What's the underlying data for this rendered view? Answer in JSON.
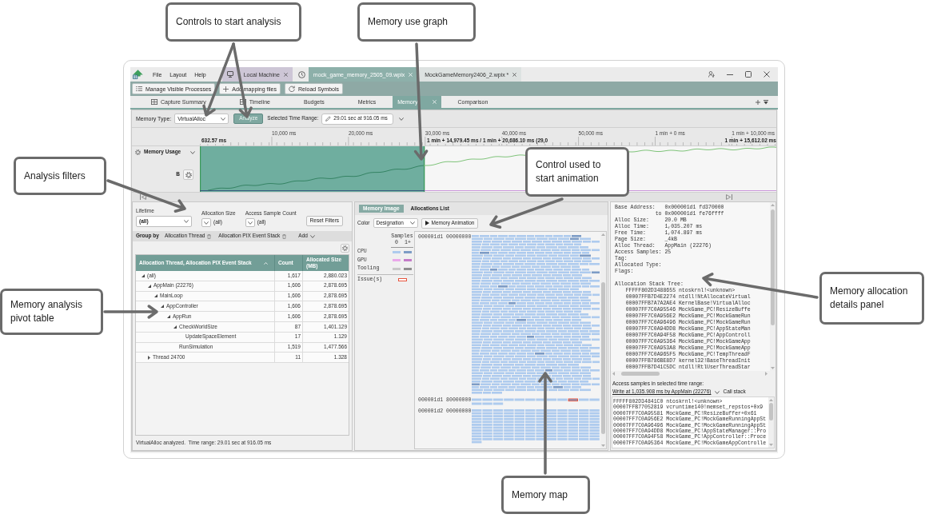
{
  "callouts": [
    {
      "text": "Controls to start analysis"
    },
    {
      "text": "Memory use graph"
    },
    {
      "text": "Analysis filters"
    },
    {
      "text": "Control used to start animation"
    },
    {
      "text": "Memory analysis pivot table"
    },
    {
      "text": "Memory allocation details panel"
    },
    {
      "text": "Memory map"
    }
  ],
  "menu": [
    "File",
    "Layout",
    "Help"
  ],
  "document_tabs": [
    {
      "label": "Local Machine",
      "kind": "connection",
      "selected": false
    },
    {
      "label": "mock_game_memory_2505_09.wpix",
      "kind": "capture",
      "selected": true
    },
    {
      "label": "MockGameMemory2406_2.wpix *",
      "kind": "capture",
      "selected": false
    }
  ],
  "toolbar": [
    "Manage Visible Processes",
    "Add mapping files",
    "Reload Symbols"
  ],
  "page_tabs": [
    {
      "label": "Capture Summary",
      "kind": "pinned",
      "selected": false
    },
    {
      "label": "Timeline",
      "kind": "pinned",
      "selected": false
    },
    {
      "label": "Budgets",
      "kind": "plain",
      "selected": false
    },
    {
      "label": "Metrics",
      "kind": "plain",
      "selected": false
    },
    {
      "label": "Memory",
      "kind": "plain",
      "selected": true
    },
    {
      "label": "Comparison",
      "kind": "plain",
      "selected": false
    }
  ],
  "analysis_bar": {
    "memory_type_label": "Memory Type:",
    "memory_type": "VirtualAlloc",
    "analyze_button": "Analyze",
    "time_range_label": "Selected Time Range:",
    "time_range": "29.01 sec at 916.05 ms"
  },
  "ruler": {
    "ticks": [
      "10,000 ms",
      "20,000 ms",
      "30,000 ms",
      "40,000 ms",
      "50,000 ms",
      "1 min + 0 ms",
      "1 min + 10,000 ms"
    ],
    "start": "632.57 ms",
    "selection": "1 min + 14,979.45 ms / 1 min + 20,686.10 ms (29,0",
    "end": "1 min + 15,612.02 ms"
  },
  "graph": {
    "title": "Memory Usage",
    "unit": "B",
    "selected_range": {
      "level": 0.39
    }
  },
  "filters": {
    "items": [
      {
        "label": "Lifetime",
        "value": "(all)",
        "kind": "dropdown"
      },
      {
        "label": "Allocation Size",
        "value": "(all)",
        "kind": "compact"
      },
      {
        "label": "Access Sample Count",
        "value": "(all)",
        "kind": "compact"
      }
    ],
    "reset_button": "Reset Filters"
  },
  "group_by": {
    "label": "Group by",
    "fields": [
      "Allocation Thread",
      "Allocation PIX Event Stack"
    ],
    "add_button": "Add"
  },
  "pivot_table": {
    "columns": [
      {
        "label": "Allocation Thread, Allocation PIX Event Stack",
        "sorted": true
      },
      {
        "label": "Count",
        "sorted": false
      },
      {
        "label": "Allocated Size (MB)",
        "sorted": false
      }
    ],
    "rows": [
      {
        "name": "(all)",
        "count": "1,617",
        "size": "2,880.023",
        "expanded": true,
        "children": [
          {
            "name": "AppMain (22276)",
            "count": "1,606",
            "size": "2,878.695",
            "expanded": true,
            "children": [
              {
                "name": "MainLoop",
                "count": "1,606",
                "size": "2,878.695",
                "expanded": true,
                "children": [
                  {
                    "name": "AppController",
                    "count": "1,606",
                    "size": "2,878.695",
                    "expanded": true,
                    "children": [
                      {
                        "name": "AppRun",
                        "count": "1,606",
                        "size": "2,878.695",
                        "expanded": true,
                        "children": [
                          {
                            "name": "CheckWorldSize",
                            "count": "87",
                            "size": "1,401.129",
                            "expanded": true,
                            "children": [
                              {
                                "name": "UpdateSpaceElement",
                                "count": "17",
                                "size": "1.129"
                              }
                            ]
                          },
                          {
                            "name": "RunSimulation",
                            "count": "1,519",
                            "size": "1,477.566"
                          }
                        ]
                      }
                    ]
                  }
                ]
              }
            ]
          },
          {
            "name": "Thread 24700",
            "count": "11",
            "size": "1.328",
            "expanded": false
          }
        ]
      }
    ]
  },
  "status": "VirtualAlloc analyzed.  Time range: 29.01 sec at 916.05 ms",
  "memory_view": {
    "tabs": [
      {
        "label": "Memory Image",
        "selected": true
      },
      {
        "label": "Allocations List",
        "selected": false
      }
    ],
    "color_label": "Color",
    "color_mode": "Designation",
    "animation_button": "Memory Animation",
    "legend": {
      "title": "Samples",
      "columns": [
        "0",
        "1+"
      ],
      "items": [
        {
          "label": "CPU",
          "swatches": [
            {
              "color": "#aecbee"
            },
            {
              "color": "#7d9cc6"
            }
          ]
        },
        {
          "label": "GPU",
          "swatches": [
            {
              "color": "#eaa8ea"
            },
            {
              "color": "#c47cc8"
            }
          ]
        },
        {
          "label": "Tooling",
          "swatches": [
            {
              "color": "#c8c8c8"
            },
            {
              "color": "#8f8f8f"
            }
          ]
        }
      ],
      "issue": {
        "label": "Issue(s)",
        "color": "#e8553f"
      }
    },
    "regions": [
      {
        "address": "000001d1 00000000"
      },
      {
        "address": "000001d1 80000000"
      },
      {
        "address": "000001d2 00000000"
      }
    ]
  },
  "allocation_details": {
    "fields": [
      {
        "label": "Base Address:",
        "value": "0x000001d1 fd370000",
        "kind": "field"
      },
      {
        "label": "to",
        "value": "0x000001d1 fe76ffff",
        "kind": "continuation"
      },
      {
        "label": "Alloc Size:",
        "value": "20.0 MB",
        "kind": "field"
      },
      {
        "label": "Alloc Time:",
        "value": "1,035.207 ms",
        "kind": "field"
      },
      {
        "label": "Free Time:",
        "value": "1,074.897 ms",
        "kind": "field"
      },
      {
        "label": "Page Size:",
        "value": "_4kB",
        "kind": "field"
      },
      {
        "label": "Alloc Thread:",
        "value": "AppMain (22276)",
        "kind": "field"
      },
      {
        "label": "Access Samples:",
        "value": "25",
        "kind": "field"
      },
      {
        "label": "Tag:",
        "kind": "field"
      },
      {
        "label": "Allocated Type:",
        "kind": "field"
      },
      {
        "label": "Flags:",
        "kind": "field"
      }
    ]
  },
  "stack_tree": {
    "title": "Allocation Stack Tree:",
    "frames": [
      {
        "address": "FFFFF802D3488655",
        "symbol": "ntoskrnl!<unknown>"
      },
      {
        "address": "00007FFB7D4E2274",
        "symbol": "ntdll!NtAllocateVirtual"
      },
      {
        "address": "00007FFB7A7A2AE4",
        "symbol": "KernelBase!VirtualAlloc"
      },
      {
        "address": "00007FF7C0A95546",
        "symbol": "MockGame_PC!ResizeBuffe"
      },
      {
        "address": "00007FF7C0A956E2",
        "symbol": "MockGame_PC!MockGameRun"
      },
      {
        "address": "00007FF7C0A96496",
        "symbol": "MockGame_PC!MockGameRun"
      },
      {
        "address": "00007FF7C0A94DD8",
        "symbol": "MockGame_PC!AppStateMan"
      },
      {
        "address": "00007FF7C0A94F58",
        "symbol": "MockGame_PC!AppControll"
      },
      {
        "address": "00007FF7C0A95364",
        "symbol": "MockGame_PC!MockGameApp"
      },
      {
        "address": "00007FF7C0A953A8",
        "symbol": "MockGame_PC!MockGameApp"
      },
      {
        "address": "00007FF7C0A965F5",
        "symbol": "MockGame_PC!TempThreadF"
      },
      {
        "address": "00007FFB786BE8D7",
        "symbol": "kernel32!BaseThreadInit"
      },
      {
        "address": "00007FFB7D41C5DC",
        "symbol": "ntdll!RtlUserThreadStar"
      }
    ]
  },
  "access_samples": {
    "title": "Access samples in selected time range:",
    "sample": "Write at 1,035.908 ms by AppMain (22276)",
    "view": "Call stack",
    "frames": [
      {
        "address": "FFFFF802D34841C0",
        "symbol": "ntoskrnl!<unknown>"
      },
      {
        "address": "00007FFB77052819",
        "symbol": "vcruntime140!memset_repstos+0x9"
      },
      {
        "address": "00007FF7C0A95581",
        "symbol": "MockGame_PC!ResizeBuffer+0x61"
      },
      {
        "address": "00007FF7C0A956E2",
        "symbol": "MockGame_PC!MockGameRunningAppSt"
      },
      {
        "address": "00007FF7C0A96496",
        "symbol": "MockGame_PC!MockGameRunningAppSt"
      },
      {
        "address": "00007FF7C0A94DD8",
        "symbol": "MockGame_PC!AppStateManager::Pro"
      },
      {
        "address": "00007FF7C0A94F58",
        "symbol": "MockGame_PC!AppController::Proce"
      },
      {
        "address": "00007FF7C0A95364",
        "symbol": "MockGame_PC!MockGameAppControlle"
      }
    ]
  }
}
